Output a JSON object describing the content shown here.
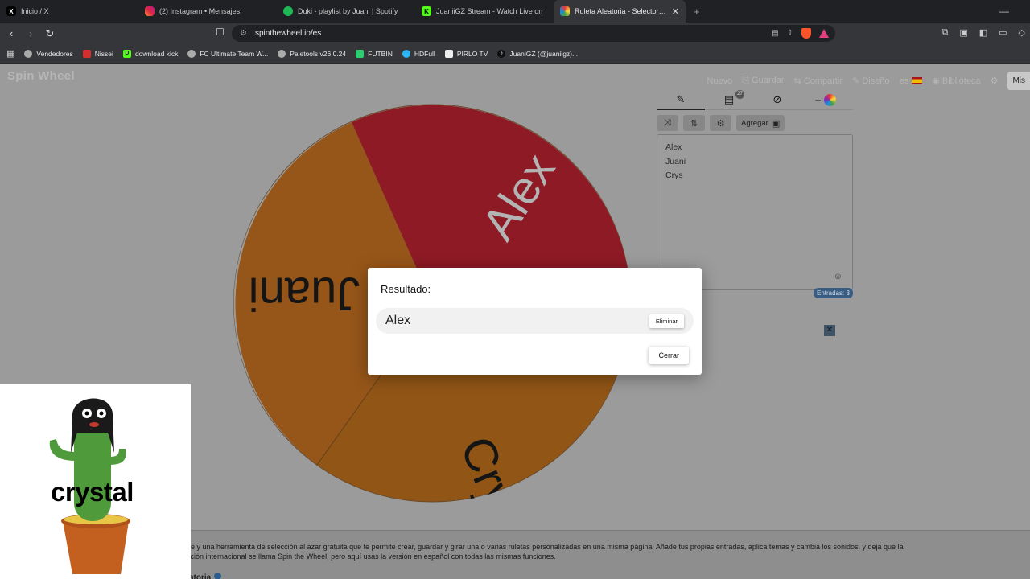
{
  "browser": {
    "tabs": [
      {
        "label": "Inicio / X",
        "fav": "X",
        "fav_color": "#000000",
        "active": false
      },
      {
        "label": "(2) Instagram • Mensajes",
        "fav": "",
        "fav_color": "#d6249f",
        "active": false
      },
      {
        "label": "Duki - playlist by Juani | Spotify",
        "fav": "",
        "fav_color": "#1db954",
        "active": false
      },
      {
        "label": "JuaniiGZ Stream - Watch Live on",
        "fav": "K",
        "fav_color": "#53fc18",
        "active": false
      },
      {
        "label": "Ruleta Aleatoria - Selector Perso",
        "fav": "",
        "fav_color": "#e53935",
        "active": true
      }
    ],
    "url": "spinthewheel.io/es",
    "bookmarks": [
      "Vendedores",
      "Nissei",
      "download kick",
      "FC Ultimate Team W...",
      "Paletools v26.0.24",
      "FUTBIN",
      "HDFull",
      "PIRLO TV",
      "JuaniGZ (@juaniigz)..."
    ]
  },
  "app": {
    "logo": "Spin Wheel",
    "nav": {
      "new": "Nuevo",
      "save": "Guardar",
      "share": "Compartir",
      "design": "Diseño",
      "lang": "es",
      "library": "Biblioteca",
      "mis": "Mis"
    },
    "wheel": {
      "segments": [
        {
          "label": "Alex",
          "color": "#8d1a24"
        },
        {
          "label": "Crys",
          "color": "#915516"
        },
        {
          "label": "Juani",
          "color": "#965619"
        }
      ]
    },
    "sidebar": {
      "tab_badge": "27",
      "add_label": "Agregar",
      "entries": [
        "Alex",
        "Juani",
        "Crys"
      ],
      "count_label": "Entradas: 3"
    },
    "dialog": {
      "title": "Resultado:",
      "result": "Alex",
      "remove_label": "Eliminar",
      "close_label": "Cerrar"
    },
    "info": {
      "line1": "online y una herramienta de selección al azar gratuita que te permite crear, guardar y girar una o varias ruletas personalizadas en una misma página. Añade tus propias entradas, aplica temas y cambia los sonidos, y deja que la",
      "line2": "plicación internacional se llama Spin the Wheel, pero aquí usas la versión en español con todas las mismas funciones.",
      "heading": "atoria"
    }
  },
  "overlay": {
    "caption": "crystal"
  }
}
